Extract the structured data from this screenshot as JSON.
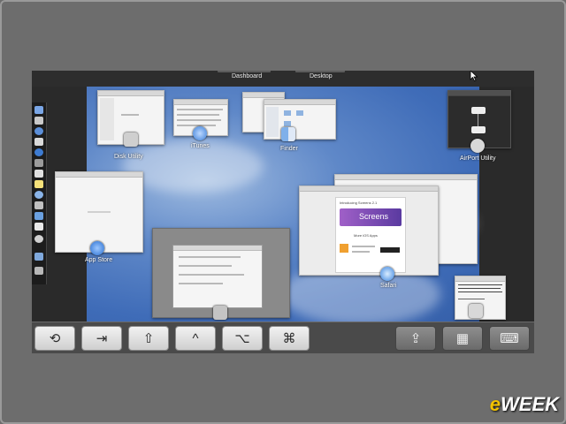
{
  "topbar": {
    "dashboard_label": "Dashboard",
    "desktop_label": "Desktop"
  },
  "apps": {
    "disk_utility": "Disk Utility",
    "itunes": "iTunes",
    "finder": "Finder",
    "airport_utility": "AirPort Utility",
    "app_store": "App Store",
    "safari": "Safari"
  },
  "safari_page": {
    "headline": "Introducing Screens 2.1",
    "product": "Screens",
    "section": "More iOS Apps"
  },
  "toolbar_keys": {
    "escape": "⟲",
    "tab": "⇥",
    "shift": "⇧",
    "control": "^",
    "option": "⌥",
    "command": "⌘",
    "share": "⇪",
    "keyboard": "▦",
    "keyboard_alt": "⌨"
  },
  "brand": {
    "e": "e",
    "rest": "WEEK"
  },
  "colors": {
    "accent": "#f2c200",
    "desktop_blue": "#3f6cb8"
  }
}
